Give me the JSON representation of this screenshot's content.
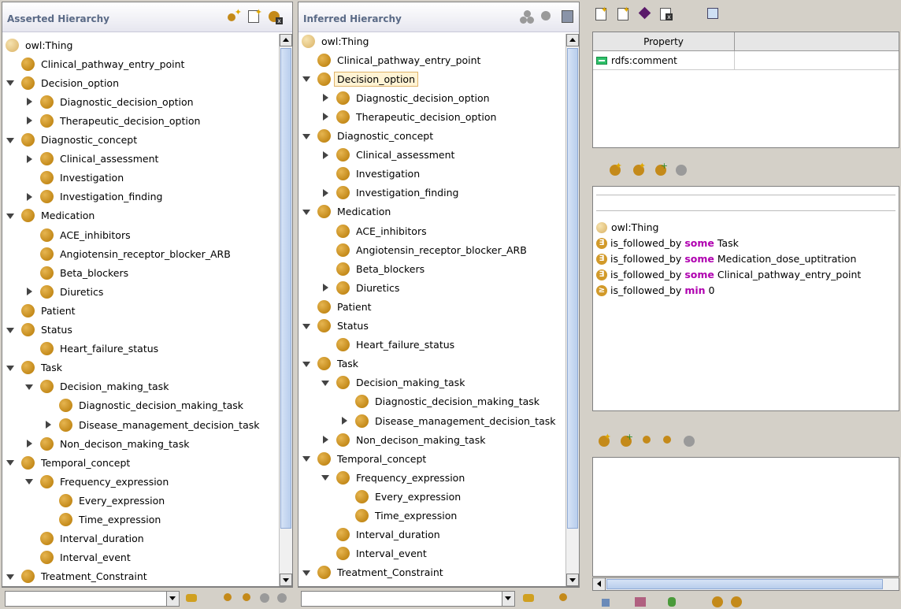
{
  "asserted": {
    "title": "Asserted Hierarchy",
    "nodes": [
      {
        "label": "owl:Thing",
        "depth": 0,
        "toggle": "none",
        "light": true
      },
      {
        "label": "Clinical_pathway_entry_point",
        "depth": 1,
        "toggle": "none"
      },
      {
        "label": "Decision_option",
        "depth": 1,
        "toggle": "down"
      },
      {
        "label": "Diagnostic_decision_option",
        "depth": 2,
        "toggle": "right"
      },
      {
        "label": "Therapeutic_decision_option",
        "depth": 2,
        "toggle": "right"
      },
      {
        "label": "Diagnostic_concept",
        "depth": 1,
        "toggle": "down"
      },
      {
        "label": "Clinical_assessment",
        "depth": 2,
        "toggle": "right"
      },
      {
        "label": "Investigation",
        "depth": 2,
        "toggle": "none"
      },
      {
        "label": "Investigation_finding",
        "depth": 2,
        "toggle": "right"
      },
      {
        "label": "Medication",
        "depth": 1,
        "toggle": "down"
      },
      {
        "label": "ACE_inhibitors",
        "depth": 2,
        "toggle": "none"
      },
      {
        "label": "Angiotensin_receptor_blocker_ARB",
        "depth": 2,
        "toggle": "none"
      },
      {
        "label": "Beta_blockers",
        "depth": 2,
        "toggle": "none"
      },
      {
        "label": "Diuretics",
        "depth": 2,
        "toggle": "right"
      },
      {
        "label": "Patient",
        "depth": 1,
        "toggle": "none"
      },
      {
        "label": "Status",
        "depth": 1,
        "toggle": "down"
      },
      {
        "label": "Heart_failure_status",
        "depth": 2,
        "toggle": "none"
      },
      {
        "label": "Task",
        "depth": 1,
        "toggle": "down"
      },
      {
        "label": "Decision_making_task",
        "depth": 2,
        "toggle": "down"
      },
      {
        "label": "Diagnostic_decision_making_task",
        "depth": 3,
        "toggle": "none"
      },
      {
        "label": "Disease_management_decision_task",
        "depth": 3,
        "toggle": "right"
      },
      {
        "label": "Non_decison_making_task",
        "depth": 2,
        "toggle": "right"
      },
      {
        "label": "Temporal_concept",
        "depth": 1,
        "toggle": "down"
      },
      {
        "label": "Frequency_expression",
        "depth": 2,
        "toggle": "down"
      },
      {
        "label": "Every_expression",
        "depth": 3,
        "toggle": "none"
      },
      {
        "label": "Time_expression",
        "depth": 3,
        "toggle": "none"
      },
      {
        "label": "Interval_duration",
        "depth": 2,
        "toggle": "none"
      },
      {
        "label": "Interval_event",
        "depth": 2,
        "toggle": "none"
      },
      {
        "label": "Treatment_Constraint",
        "depth": 1,
        "toggle": "down"
      }
    ]
  },
  "inferred": {
    "title": "Inferred Hierarchy",
    "nodes": [
      {
        "label": "owl:Thing",
        "depth": 0,
        "toggle": "none",
        "light": true
      },
      {
        "label": "Clinical_pathway_entry_point",
        "depth": 1,
        "toggle": "none"
      },
      {
        "label": "Decision_option",
        "depth": 1,
        "toggle": "down",
        "selected": true
      },
      {
        "label": "Diagnostic_decision_option",
        "depth": 2,
        "toggle": "right"
      },
      {
        "label": "Therapeutic_decision_option",
        "depth": 2,
        "toggle": "right"
      },
      {
        "label": "Diagnostic_concept",
        "depth": 1,
        "toggle": "down"
      },
      {
        "label": "Clinical_assessment",
        "depth": 2,
        "toggle": "right"
      },
      {
        "label": "Investigation",
        "depth": 2,
        "toggle": "none"
      },
      {
        "label": "Investigation_finding",
        "depth": 2,
        "toggle": "right"
      },
      {
        "label": "Medication",
        "depth": 1,
        "toggle": "down"
      },
      {
        "label": "ACE_inhibitors",
        "depth": 2,
        "toggle": "none"
      },
      {
        "label": "Angiotensin_receptor_blocker_ARB",
        "depth": 2,
        "toggle": "none"
      },
      {
        "label": "Beta_blockers",
        "depth": 2,
        "toggle": "none"
      },
      {
        "label": "Diuretics",
        "depth": 2,
        "toggle": "right"
      },
      {
        "label": "Patient",
        "depth": 1,
        "toggle": "none"
      },
      {
        "label": "Status",
        "depth": 1,
        "toggle": "down"
      },
      {
        "label": "Heart_failure_status",
        "depth": 2,
        "toggle": "none"
      },
      {
        "label": "Task",
        "depth": 1,
        "toggle": "down"
      },
      {
        "label": "Decision_making_task",
        "depth": 2,
        "toggle": "down"
      },
      {
        "label": "Diagnostic_decision_making_task",
        "depth": 3,
        "toggle": "none"
      },
      {
        "label": "Disease_management_decision_task",
        "depth": 3,
        "toggle": "right"
      },
      {
        "label": "Non_decison_making_task",
        "depth": 2,
        "toggle": "right"
      },
      {
        "label": "Temporal_concept",
        "depth": 1,
        "toggle": "down"
      },
      {
        "label": "Frequency_expression",
        "depth": 2,
        "toggle": "down"
      },
      {
        "label": "Every_expression",
        "depth": 3,
        "toggle": "none"
      },
      {
        "label": "Time_expression",
        "depth": 3,
        "toggle": "none"
      },
      {
        "label": "Interval_duration",
        "depth": 2,
        "toggle": "none"
      },
      {
        "label": "Interval_event",
        "depth": 2,
        "toggle": "none"
      },
      {
        "label": "Treatment_Constraint",
        "depth": 1,
        "toggle": "down"
      }
    ]
  },
  "properties": {
    "column_header": "Property",
    "rows": [
      {
        "name": "rdfs:comment"
      }
    ]
  },
  "conditions": {
    "superclass": "owl:Thing",
    "items": [
      {
        "badge": "∃",
        "property": "is_followed_by",
        "quantifier": "some",
        "filler": "Task"
      },
      {
        "badge": "∃",
        "property": "is_followed_by",
        "quantifier": "some",
        "filler": "Medication_dose_uptitration"
      },
      {
        "badge": "∃",
        "property": "is_followed_by",
        "quantifier": "some",
        "filler": "Clinical_pathway_entry_point"
      },
      {
        "badge": "≥",
        "property": "is_followed_by",
        "quantifier": "min",
        "filler": "0"
      }
    ]
  },
  "colors": {
    "class_icon": "#c48a1a",
    "selection": "#fff3d4",
    "keyword": "#b000b0",
    "title": "#5a6a86"
  }
}
